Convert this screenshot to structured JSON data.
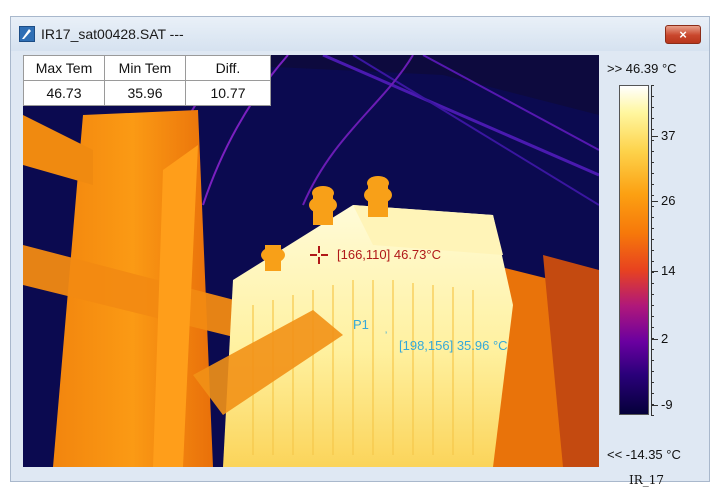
{
  "window": {
    "title": "IR17_sat00428.SAT ---",
    "close_glyph": "×"
  },
  "temperature_table": {
    "headers": [
      "Max Tem",
      "Min Tem",
      "Diff."
    ],
    "values": [
      "46.73",
      "35.96",
      "10.77"
    ]
  },
  "markers": {
    "max": {
      "label": "[166,110]  46.73°C"
    },
    "point": {
      "name": "P1",
      "label": "[198,156] 35.96 °C"
    }
  },
  "scale": {
    "max_label": ">> 46.39 °C",
    "min_label": "<< -14.35 °C",
    "ticks": [
      {
        "label": "37",
        "level": 0.845
      },
      {
        "label": "26",
        "level": 0.65
      },
      {
        "label": "14",
        "level": 0.435
      },
      {
        "label": "2",
        "level": 0.23
      },
      {
        "label": "-9",
        "level": 0.03
      }
    ],
    "palette_name": "IR_17"
  },
  "colors": {
    "hot_marker": "#b01818",
    "cold_marker": "#36a9d8"
  }
}
